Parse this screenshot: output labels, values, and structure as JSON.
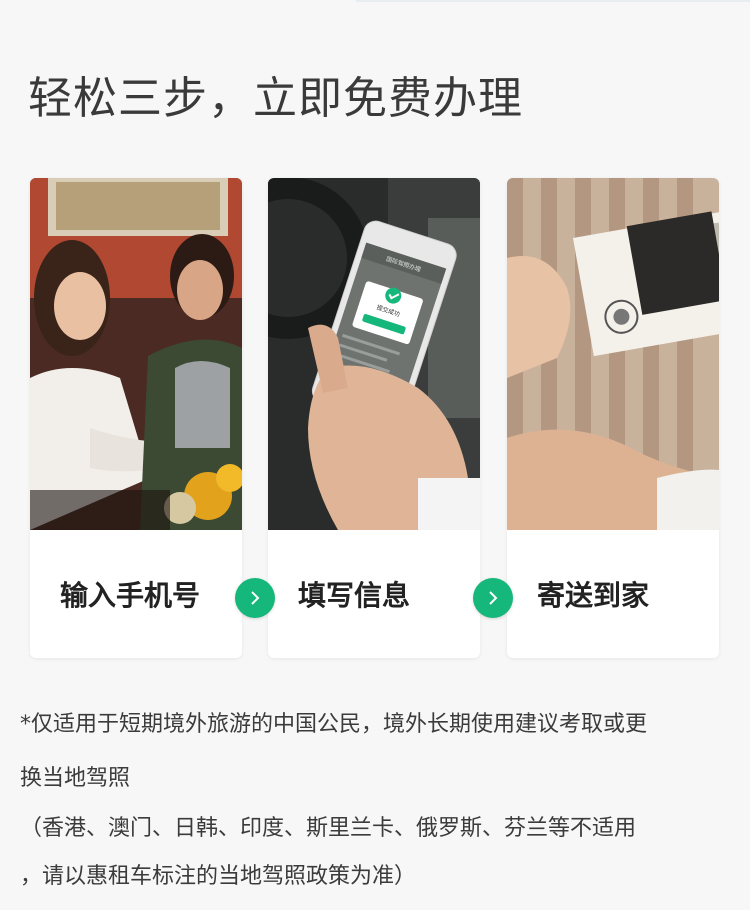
{
  "title": "轻松三步，立即免费办理",
  "steps": [
    {
      "label": "输入手机号",
      "image": "two-women-at-counter-photo"
    },
    {
      "label": "填写信息",
      "image": "hand-holding-phone-photo"
    },
    {
      "label": "寄送到家",
      "image": "handing-over-license-photo"
    }
  ],
  "phone_screen": {
    "header": "国际驾照办理",
    "popup": "提交成功"
  },
  "note": {
    "line1": "*仅适用于短期境外旅游的中国公民，境外长期使用建议考取或更",
    "line2": "换当地驾照",
    "line3": "（香港、澳门、日韩、印度、斯里兰卡、俄罗斯、芬兰等不适用",
    "line4": "，请以惠租车标注的当地驾照政策为准）"
  },
  "colors": {
    "accent": "#15b77a",
    "background": "#f7f7f7",
    "card": "#ffffff"
  }
}
